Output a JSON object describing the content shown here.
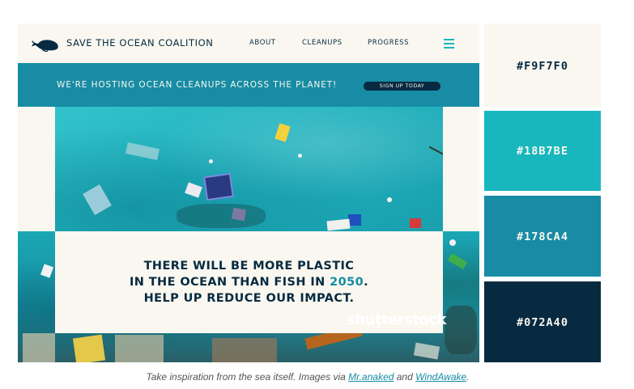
{
  "header": {
    "brand": "SAVE THE OCEAN COALITION",
    "logo_icon": "whale-icon",
    "nav": [
      "ABOUT",
      "CLEANUPS",
      "PROGRESS"
    ],
    "menu_icon": "hamburger-menu-icon"
  },
  "banner": {
    "text": "WE'RE HOSTING OCEAN CLEANUPS ACROSS THE PLANET!",
    "button": "SIGN UP TODAY"
  },
  "message": {
    "line1": "THERE WILL BE MORE PLASTIC",
    "line2_prefix": "IN THE OCEAN THAN FISH IN ",
    "line2_highlight": "2050",
    "line2_suffix": ".",
    "line3": "HELP UP REDUCE OUR IMPACT."
  },
  "watermark": "shutterstock",
  "palette": [
    {
      "hex": "#F9F7F0",
      "text_color": "#072A40"
    },
    {
      "hex": "#18B7BE",
      "text_color": "#F9F7F0"
    },
    {
      "hex": "#178CA4",
      "text_color": "#F9F7F0"
    },
    {
      "hex": "#072A40",
      "text_color": "#F9F7F0"
    }
  ],
  "caption": {
    "prefix": "Take inspiration from the sea itself. Images via ",
    "link1": "Mr.anaked",
    "middle": " and ",
    "link2": "WindAwake",
    "suffix": "."
  }
}
